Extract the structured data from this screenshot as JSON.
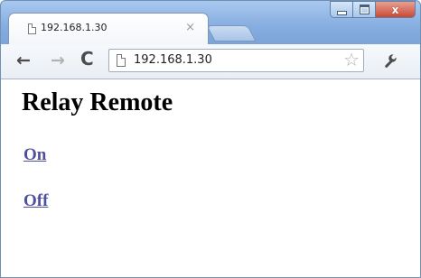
{
  "browser": {
    "tab": {
      "title": "192.168.1.30",
      "close_glyph": "×",
      "favicon": "page-icon"
    },
    "window_controls": {
      "minimize_icon": "minimize-icon",
      "maximize_icon": "maximize-icon",
      "close_icon": "close-icon",
      "close_glyph": "x"
    },
    "toolbar": {
      "back_glyph": "←",
      "forward_glyph": "→",
      "reload_glyph": "C",
      "url": "192.168.1.30",
      "star_glyph": "☆",
      "menu_icon": "wrench-icon"
    }
  },
  "page": {
    "heading": "Relay Remote",
    "links": [
      {
        "label": "On"
      },
      {
        "label": "Off"
      }
    ]
  },
  "colors": {
    "link": "#4f4fa0",
    "titlebar": "#86ade0",
    "close_button": "#c94a34"
  }
}
